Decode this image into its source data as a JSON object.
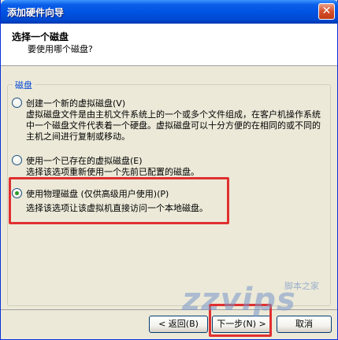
{
  "window": {
    "title": "添加硬件向导"
  },
  "header": {
    "title": "选择一个磁盘",
    "subtitle": "要使用哪个磁盘?"
  },
  "group": {
    "legend": "磁盘"
  },
  "options": [
    {
      "label": "创建一个新的虚拟磁盘(V)",
      "description": "虚拟磁盘文件是由主机文件系统上的一个或多个文件组成，在客户机操作系统中一个磁盘文件代表着一个硬盘。虚拟磁盘可以十分方便的在相同的或不同的主机之间进行复制或移动。",
      "checked": false
    },
    {
      "label": "使用一个已存在的虚拟磁盘(E)",
      "description": "选择该选项重新使用一个先前已配置的磁盘。",
      "checked": false
    },
    {
      "label": "使用物理磁盘 (仅供高级用户使用)(P)",
      "description": "选择该选项让该虚拟机直接访问一个本地磁盘。",
      "checked": true
    }
  ],
  "buttons": {
    "back": "< 返回(B)",
    "next": "下一步(N) >",
    "cancel": "取消"
  },
  "watermark": {
    "text": "zzvips",
    "small": "脚本之家"
  },
  "colors": {
    "titlebar": "#0054e3",
    "highlight": "#e03030",
    "legend": "#0046d5"
  }
}
